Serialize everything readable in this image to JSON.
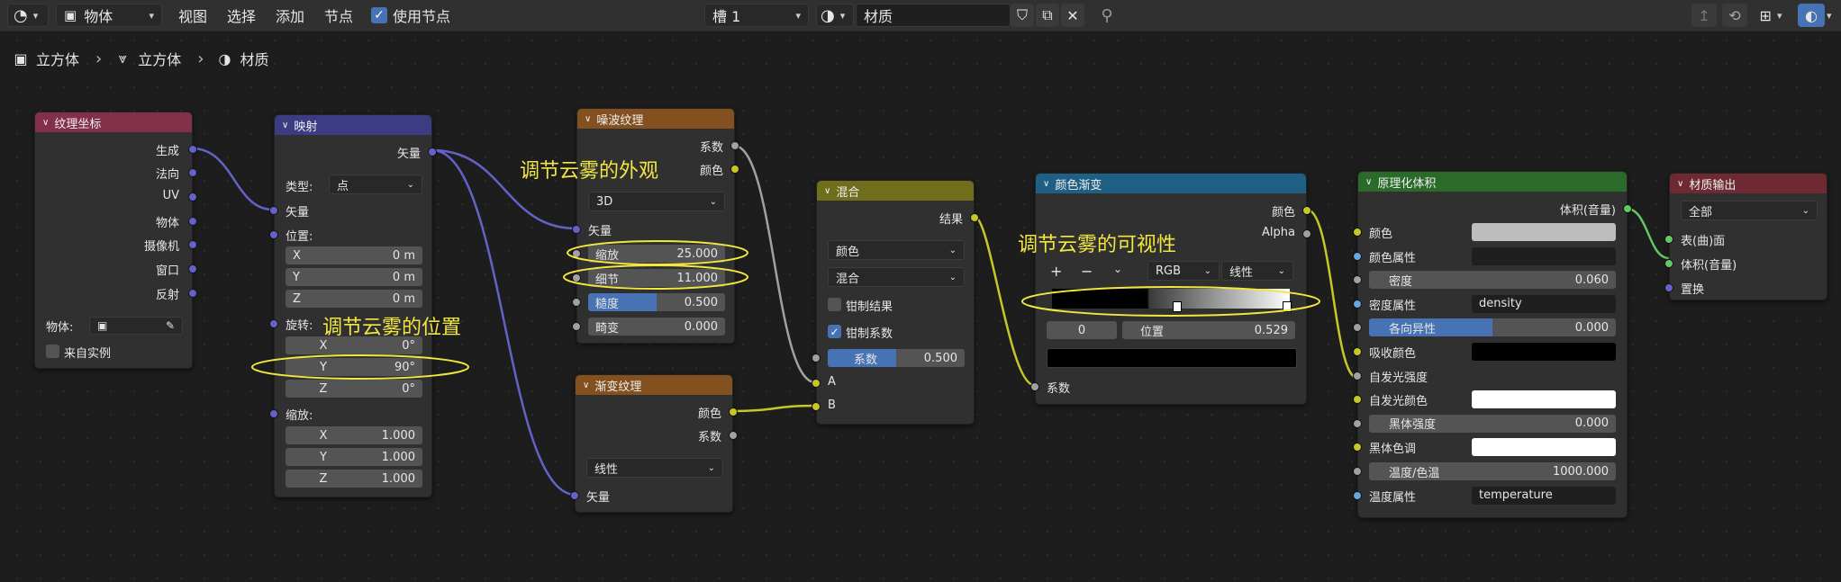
{
  "header": {
    "mode": "物体",
    "menus": [
      "视图",
      "选择",
      "添加",
      "节点"
    ],
    "use_nodes_label": "使用节点",
    "slot": "槽 1",
    "material_name": "材质"
  },
  "breadcrumb": [
    "立方体",
    "立方体",
    "材质"
  ],
  "annotations": {
    "appearance": "调节云雾的外观",
    "position": "调节云雾的位置",
    "visibility": "调节云雾的可视性",
    "color": "#f2e640"
  },
  "nodes": {
    "texcoord": {
      "title": "纹理坐标",
      "color": "#83314a",
      "outputs": [
        "生成",
        "法向",
        "UV",
        "物体",
        "摄像机",
        "窗口",
        "反射"
      ],
      "object_label": "物体:",
      "from_instancer": "来自实例"
    },
    "mapping": {
      "title": "映射",
      "color": "#3c3c83",
      "output": "矢量",
      "type_label": "类型:",
      "type_value": "点",
      "vector_input": "矢量",
      "location_label": "位置:",
      "location": [
        {
          "axis": "X",
          "value": "0 m"
        },
        {
          "axis": "Y",
          "value": "0 m"
        },
        {
          "axis": "Z",
          "value": "0 m"
        }
      ],
      "rotation_label": "旋转:",
      "rotation": [
        {
          "axis": "X",
          "value": "0°"
        },
        {
          "axis": "Y",
          "value": "90°"
        },
        {
          "axis": "Z",
          "value": "0°"
        }
      ],
      "scale_label": "缩放:",
      "scale": [
        {
          "axis": "X",
          "value": "1.000"
        },
        {
          "axis": "Y",
          "value": "1.000"
        },
        {
          "axis": "Z",
          "value": "1.000"
        }
      ]
    },
    "noise": {
      "title": "噪波纹理",
      "color": "#83501f",
      "outputs": [
        "系数",
        "颜色"
      ],
      "dimensions": "3D",
      "vector_input": "矢量",
      "fields": [
        {
          "name": "缩放",
          "value": "25.000"
        },
        {
          "name": "细节",
          "value": "11.000"
        },
        {
          "name": "糙度",
          "value": "0.500",
          "fill": 0.5
        },
        {
          "name": "畸变",
          "value": "0.000"
        }
      ]
    },
    "gradient": {
      "title": "渐变纹理",
      "color": "#83501f",
      "outputs": [
        "颜色",
        "系数"
      ],
      "type_value": "线性",
      "vector_input": "矢量"
    },
    "mix": {
      "title": "混合",
      "color": "#6e6e1d",
      "output": "结果",
      "data_type": "颜色",
      "blend_type": "混合",
      "clamp_result": "钳制结果",
      "clamp_factor": "钳制系数",
      "factor_name": "系数",
      "factor_value": "0.500",
      "factor_fill": 0.5,
      "inputs": [
        "A",
        "B"
      ]
    },
    "colorramp": {
      "title": "颜色渐变",
      "color": "#1f5f83",
      "outputs": [
        "颜色",
        "Alpha"
      ],
      "plus": "+",
      "minus": "−",
      "color_mode": "RGB",
      "interpolation": "线性",
      "index": "0",
      "position_label": "位置",
      "position_value": "0.529",
      "input": "系数"
    },
    "volume": {
      "title": "原理化体积",
      "color": "#2a6b2a",
      "output": "体积(音量)",
      "rows": [
        {
          "label": "颜色",
          "type": "swatch",
          "swatch": "#bdbdbd",
          "socket": "yel"
        },
        {
          "label": "颜色属性",
          "type": "text",
          "value": "",
          "socket": "blu"
        },
        {
          "label": "密度",
          "type": "num",
          "value": "0.060",
          "socket": "gry"
        },
        {
          "label": "密度属性",
          "type": "text",
          "value": "density",
          "socket": "blu"
        },
        {
          "label": "各向异性",
          "type": "num",
          "value": "0.000",
          "fill": 0.5,
          "socket": "gry"
        },
        {
          "label": "吸收颜色",
          "type": "swatch",
          "swatch": "#000000",
          "socket": "yel"
        },
        {
          "label": "自发光强度",
          "type": "plain",
          "socket": "gry"
        },
        {
          "label": "自发光颜色",
          "type": "swatch",
          "swatch": "#ffffff",
          "socket": "yel"
        },
        {
          "label": "黑体强度",
          "type": "num",
          "value": "0.000",
          "socket": "gry"
        },
        {
          "label": "黑体色调",
          "type": "swatch",
          "swatch": "#ffffff",
          "socket": "yel"
        },
        {
          "label": "温度/色温",
          "type": "num",
          "value": "1000.000",
          "socket": "gry"
        },
        {
          "label": "温度属性",
          "type": "text",
          "value": "temperature",
          "socket": "blu"
        }
      ]
    },
    "output": {
      "title": "材质输出",
      "color": "#6e2a33",
      "target": "全部",
      "inputs": [
        "表(曲)面",
        "体积(音量)",
        "置换"
      ]
    }
  }
}
